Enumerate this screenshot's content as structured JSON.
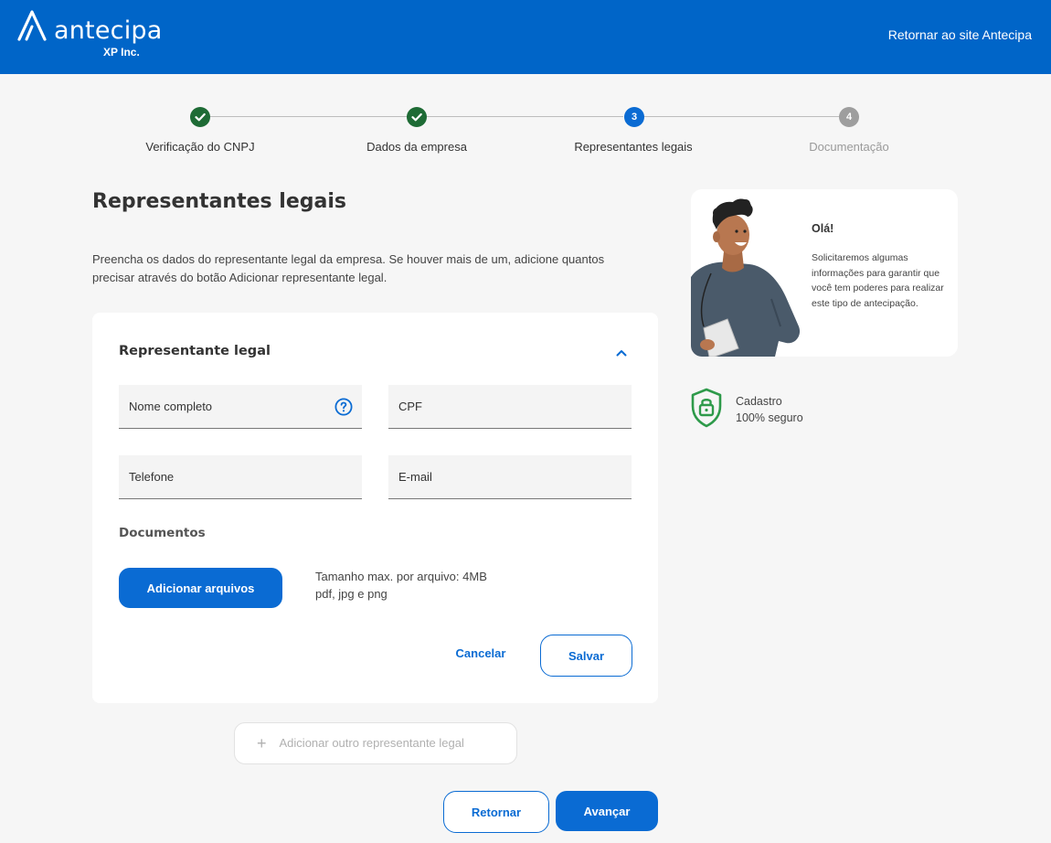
{
  "header": {
    "brand": "antecipa",
    "brand_sub": "XP Inc.",
    "back_link": "Retornar ao site Antecipa"
  },
  "stepper": {
    "steps": [
      {
        "label": "Verificação do CNPJ",
        "status": "done"
      },
      {
        "label": "Dados da empresa",
        "status": "done"
      },
      {
        "label": "Representantes legais",
        "status": "current",
        "number": "3"
      },
      {
        "label": "Documentação",
        "status": "todo",
        "number": "4"
      }
    ]
  },
  "main": {
    "title": "Representantes legais",
    "intro": "Preencha os dados do representante legal da empresa. Se houver mais de um, adicione quantos precisar através do botão Adicionar representante legal."
  },
  "form": {
    "section_title": "Representante legal",
    "fields": {
      "name_placeholder": "Nome completo",
      "cpf_placeholder": "CPF",
      "phone_placeholder": "Telefone",
      "email_placeholder": "E-mail"
    },
    "documents_title": "Documentos",
    "add_files_label": "Adicionar arquivos",
    "file_info_line1": "Tamanho max. por arquivo: 4MB",
    "file_info_line2": "pdf, jpg e png",
    "cancel_label": "Cancelar",
    "save_label": "Salvar"
  },
  "add_representative_label": "Adicionar outro representante legal",
  "footer": {
    "back_label": "Retornar",
    "next_label": "Avançar"
  },
  "side": {
    "hello": "Olá!",
    "text": "Solicitaremos algumas informações para garantir que você tem poderes para realizar este tipo de antecipação.",
    "secure_line1": "Cadastro",
    "secure_line2": "100% seguro"
  },
  "colors": {
    "brand_blue": "#0065c8",
    "accent_blue": "#0a6bd3",
    "done_green": "#1e6b35",
    "secure_green": "#2e9a4a"
  },
  "icons": [
    "logo-mark-icon",
    "check-icon",
    "chevron-up-icon",
    "help-circle-icon",
    "plus-icon",
    "shield-lock-icon"
  ]
}
